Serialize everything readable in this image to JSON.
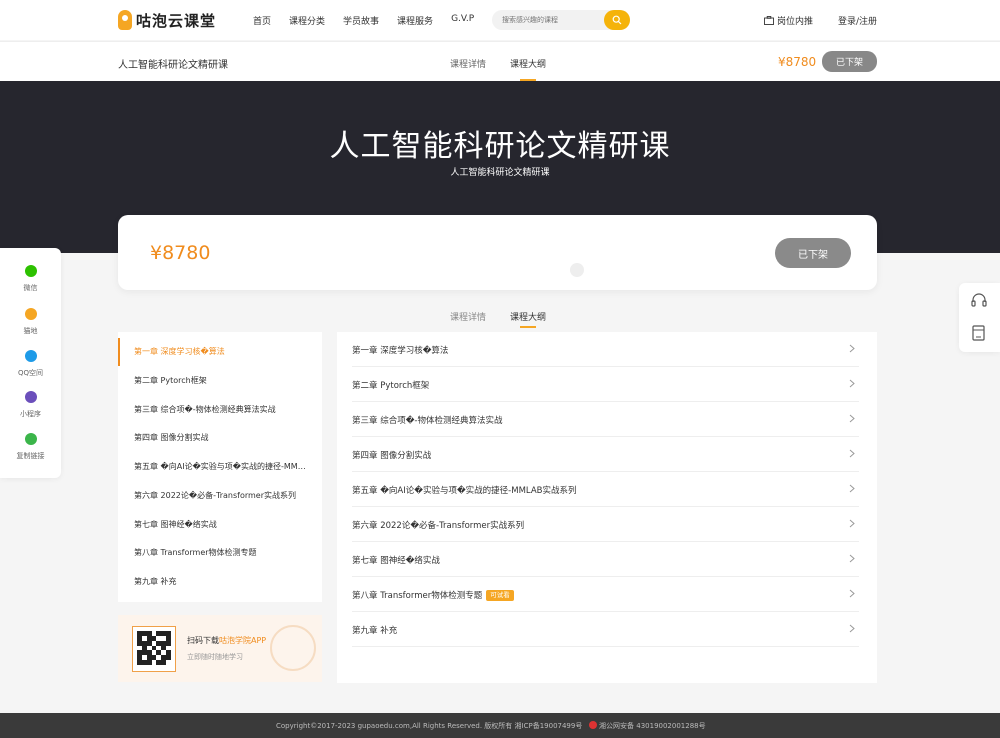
{
  "header": {
    "logo_text": "咕泡云课堂",
    "nav": [
      "首页",
      "课程分类",
      "学员故事",
      "课程服务",
      "G.V.P"
    ],
    "search_placeholder": "搜索感兴趣的课程",
    "job_label": "岗位内推",
    "login_label": "登录/注册"
  },
  "coursebar": {
    "title": "人工智能科研论文精研课",
    "tabs": [
      "课程详情",
      "课程大纲"
    ],
    "price": "¥8780",
    "button": "已下架"
  },
  "hero": {
    "title": "人工智能科研论文精研课",
    "subtitle": "人工智能科研论文精研课"
  },
  "pricecard": {
    "price": "¥8780",
    "button": "已下架"
  },
  "tabs": [
    "课程详情",
    "课程大纲"
  ],
  "share": [
    {
      "label": "微信",
      "icon": "wechat-icon",
      "color": "#2dc100"
    },
    {
      "label": "猫地",
      "icon": "cat-icon",
      "color": "#f5a623"
    },
    {
      "label": "QQ空间",
      "icon": "qq-icon",
      "color": "#1e9be8"
    },
    {
      "label": "小程序",
      "icon": "mini-program-icon",
      "color": "#6b4fbb"
    },
    {
      "label": "复制链接",
      "icon": "link-icon",
      "color": "#3bb54a"
    }
  ],
  "chapters": [
    {
      "title": "第一章 深度学习核�算法",
      "trial": ""
    },
    {
      "title": "第二章 Pytorch框架",
      "trial": ""
    },
    {
      "title": "第三章 综合项�-物体检测经典算法实战",
      "trial": ""
    },
    {
      "title": "第四章 图像分割实战",
      "trial": ""
    },
    {
      "title": "第五章 �向AI论�实验与项�实战的捷径-MMLAB实战系列",
      "trial": ""
    },
    {
      "title": "第六章 2022论�必备-Transformer实战系列",
      "trial": ""
    },
    {
      "title": "第七章 图神经�络实战",
      "trial": ""
    },
    {
      "title": "第八章 Transformer物体检测专题",
      "trial": "可试看"
    },
    {
      "title": "第九章 补充",
      "trial": ""
    }
  ],
  "app": {
    "line1_prefix": "扫码下载",
    "line1_highlight": "咕泡学院APP",
    "line2": "立即随时随地学习"
  },
  "footer": {
    "copyright": "Copyright©2017-2023 gupaoedu.com,All Rights Reserved. 版权所有  湘ICP备19007499号",
    "police": "湘公网安备 43019002001288号"
  },
  "colors": {
    "accent": "#f08c1e",
    "search_button": "#f5b30a",
    "hero_bg": "#26262e",
    "disabled_button": "#888888"
  }
}
